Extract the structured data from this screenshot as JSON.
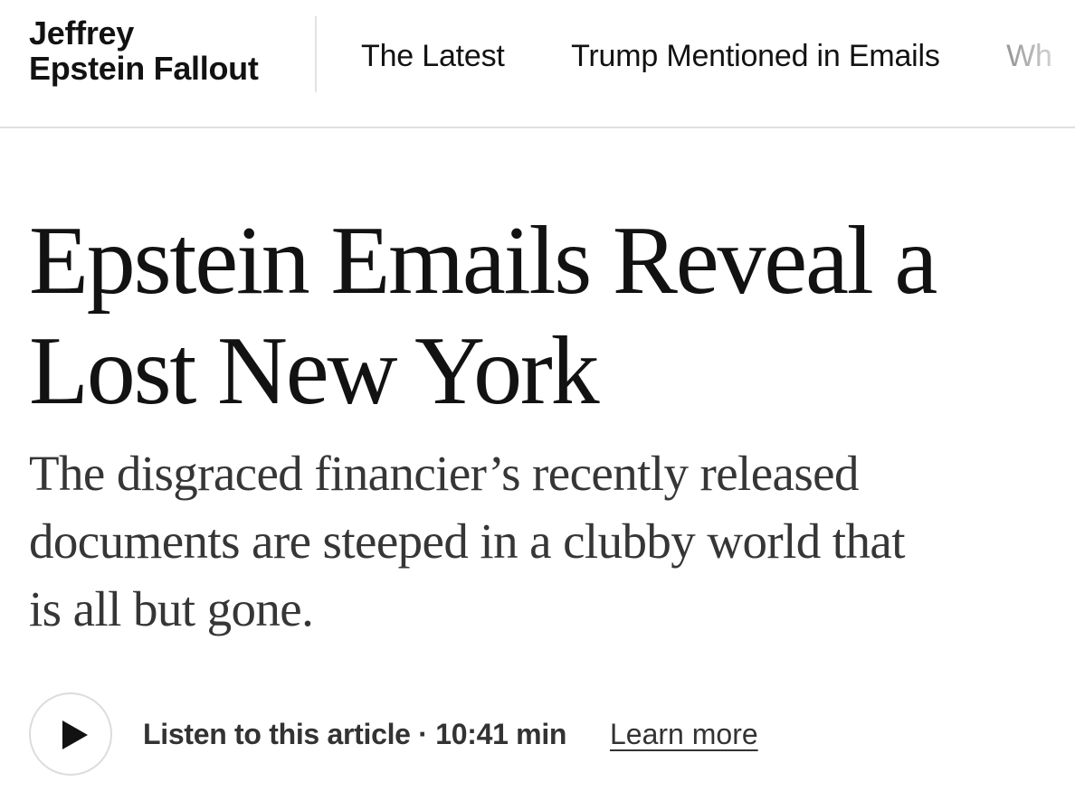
{
  "section": {
    "title_line1": "Jeffrey",
    "title_line2": "Epstein Fallout"
  },
  "nav": {
    "items": [
      {
        "label": "The Latest"
      },
      {
        "label": "Trump Mentioned in Emails"
      },
      {
        "label": "Wh"
      }
    ]
  },
  "article": {
    "headline_line1": "Epstein Emails Reveal a",
    "headline_line2": "Lost New York",
    "summary_line1": "The disgraced financier’s recently released",
    "summary_line2": "documents are steeped in a clubby world that",
    "summary_line3": "is all but gone."
  },
  "audio": {
    "play_icon": "play-icon",
    "listen_label": "Listen to this article",
    "separator": " · ",
    "duration": "10:41 min",
    "learn_more": "Learn more"
  },
  "colors": {
    "text": "#121212",
    "summary_text": "#363636",
    "divider": "#dfdfdf",
    "faded_nav": "#9a9a9a"
  }
}
